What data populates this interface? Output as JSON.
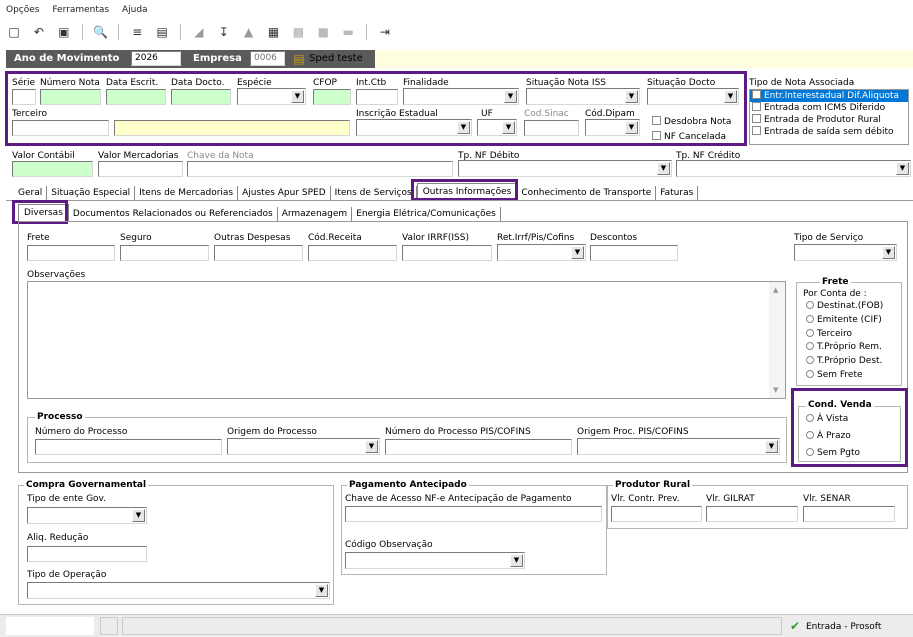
{
  "menu": {
    "items": [
      "Opções",
      "Ferramentas",
      "Ajuda"
    ]
  },
  "toolbar": {
    "icons": [
      "new-document-icon",
      "undo-icon",
      "save-icon",
      "print-preview-icon",
      "list-icon",
      "copy-icon",
      "folder-icon",
      "export-icon",
      "lock-icon",
      "calculator-icon",
      "grid-icon",
      "block-icon",
      "dash-icon",
      "exit-icon"
    ]
  },
  "header": {
    "ano_label": "Ano de Movimento",
    "ano_value": "2026",
    "empresa_label": "Empresa",
    "empresa_code": "0006",
    "empresa_name": "Sped teste"
  },
  "nota": {
    "serie": "Série",
    "numero_nota": "Número Nota",
    "data_escrit": "Data Escrit.",
    "data_docto": "Data Docto.",
    "especie": "Espécie",
    "cfop": "CFOP",
    "int_ctb": "Int.Ctb",
    "finalidade": "Finalidade",
    "situacao_iss": "Situação Nota ISS",
    "situacao_docto": "Situação Docto",
    "terceiro": "Terceiro",
    "inscricao_estadual": "Inscrição Estadual",
    "uf": "UF",
    "cod_sinac": "Cod.Sinac",
    "cod_dipam": "Cód.Dipam",
    "desdobra_nota": "Desdobra Nota",
    "nf_cancelada": "NF Cancelada"
  },
  "tipo_nota": {
    "label": "Tipo de Nota Associada",
    "items": [
      "Entr.Interestadual Dif.Aliquota",
      "Entrada com ICMS Diferido",
      "Entrada de Produtor Rural",
      "Entrada de saída sem débito"
    ]
  },
  "valores": {
    "valor_contabil": "Valor Contábil",
    "valor_mercadorias": "Valor Mercadorias",
    "chave_nota": "Chave da Nota",
    "tp_nf_debito": "Tp. NF Débito",
    "tp_nf_credito": "Tp. NF Crédito"
  },
  "tabs": [
    "Geral",
    "Situação Especial",
    "Itens de Mercadorias",
    "Ajustes Apur SPED",
    "Itens de Serviços",
    "Outras Informações",
    "Conhecimento de Transporte",
    "Faturas"
  ],
  "subtabs": [
    "Diversas",
    "Documentos Relacionados ou Referenciados",
    "Armazenagem",
    "Energia Elétrica/Comunicações"
  ],
  "diversas": {
    "frete": "Frete",
    "seguro": "Seguro",
    "outras_despesas": "Outras Despesas",
    "cod_receita": "Cód.Receita",
    "valor_irrf": "Valor IRRF(ISS)",
    "ret_irrf": "Ret.Irrf/Pis/Cofins",
    "descontos": "Descontos",
    "tipo_servico": "Tipo de Serviço",
    "observacoes": "Observações"
  },
  "frete_group": {
    "title": "Frete",
    "subtitle": "Por Conta de :",
    "options": [
      "Destinat.(FOB)",
      "Emitente (CIF)",
      "Terceiro",
      "T.Próprio Rem.",
      "T.Próprio Dest.",
      "Sem Frete"
    ]
  },
  "processo": {
    "title": "Processo",
    "numero": "Número do Processo",
    "origem": "Origem do Processo",
    "numero_pis": "Número do Processo PIS/COFINS",
    "origem_pis": "Origem Proc. PIS/COFINS"
  },
  "cond_venda": {
    "title": "Cond. Venda",
    "options": [
      "À Vista",
      "À Prazo",
      "Sem Pgto"
    ]
  },
  "compra_gov": {
    "title": "Compra Governamental",
    "tipo_ente": "Tipo de ente Gov.",
    "aliq_reducao": "Aliq. Redução",
    "tipo_operacao": "Tipo de Operação"
  },
  "pagamento": {
    "title": "Pagamento Antecipado",
    "chave": "Chave de Acesso NF-e Antecipação de Pagamento",
    "codigo_obs": "Código Observação"
  },
  "produtor": {
    "title": "Produtor Rural",
    "contr_prev": "Vlr. Contr. Prev.",
    "gilrat": "Vlr. GILRAT",
    "senar": "Vlr. SENAR"
  },
  "status": {
    "text": "Entrada - Prosoft"
  },
  "colors": {
    "highlight": "#5c1a82",
    "header_bg": "#5a5a5a",
    "selection": "#0078d7"
  }
}
